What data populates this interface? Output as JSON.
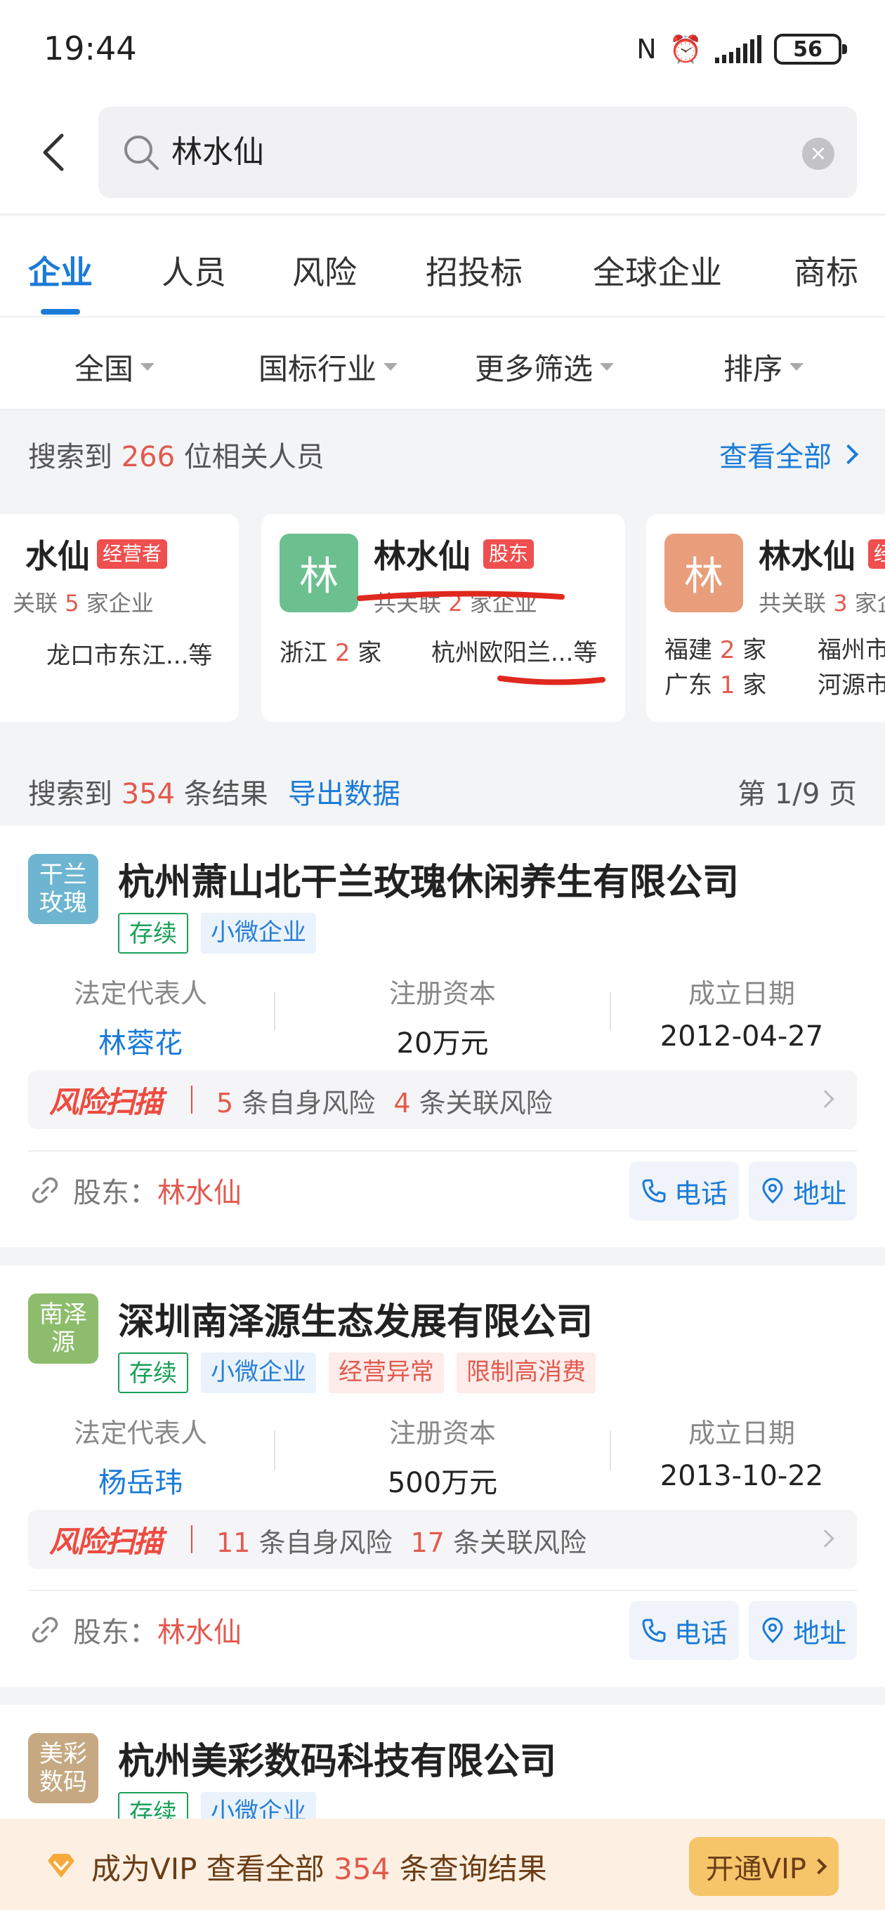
{
  "status": {
    "time": "19:44",
    "battery": "56"
  },
  "search": {
    "query": "林水仙",
    "clear": "×"
  },
  "tabs": [
    {
      "label": "企业",
      "active": true
    },
    {
      "label": "人员"
    },
    {
      "label": "风险"
    },
    {
      "label": "招投标"
    },
    {
      "label": "全球企业"
    },
    {
      "label": "商标"
    }
  ],
  "filters": [
    "全国",
    "国标行业",
    "更多筛选",
    "排序"
  ],
  "persons": {
    "prefix": "搜索到",
    "count": "266",
    "suffix": "位相关人员",
    "view_all": "查看全部",
    "cards": [
      {
        "avatar": "",
        "name": "水仙",
        "tag": "经营者",
        "sub_prefix": "关联",
        "sub_count": "5",
        "sub_suffix": "家企业",
        "line1": "龙口市东江...等"
      },
      {
        "avatar": "林",
        "avatar_color": "#6cc090",
        "name": "林水仙",
        "tag": "股东",
        "sub_prefix": "共关联",
        "sub_count": "2",
        "sub_suffix": "家企业",
        "region1": "浙江",
        "region1_count": "2",
        "unit": "家",
        "company1": "杭州欧阳兰...等"
      },
      {
        "avatar": "林",
        "avatar_color": "#e89e7b",
        "name": "林水仙",
        "tag": "经",
        "sub_prefix": "共关联",
        "sub_count": "3",
        "sub_suffix": "家企",
        "region1": "福建",
        "region1_count": "2",
        "region2": "广东",
        "region2_count": "1",
        "unit": "家",
        "company1": "福州市",
        "company2": "河源市"
      }
    ]
  },
  "results": {
    "prefix": "搜索到",
    "count": "354",
    "suffix": "条结果",
    "export": "导出数据",
    "page": "第 1/9 页"
  },
  "labels": {
    "legal_rep": "法定代表人",
    "capital": "注册资本",
    "founded": "成立日期",
    "risk_brand": "风险扫描",
    "self_risk": "条自身风险",
    "rel_risk": "条关联风险",
    "shareholder": "股东：",
    "phone": "电话",
    "address": "地址"
  },
  "companies": [
    {
      "logo": "干兰玫瑰",
      "logo_color": "#6db5d0",
      "name": "杭州萧山北干兰玫瑰休闲养生有限公司",
      "tags": [
        {
          "text": "存续",
          "style": "green"
        },
        {
          "text": "小微企业",
          "style": "blue"
        }
      ],
      "legal_rep": "林蓉花",
      "capital": "20万元",
      "founded": "2012-04-27",
      "self_risk": "5",
      "rel_risk": "4",
      "shareholder": "林水仙"
    },
    {
      "logo": "南泽源",
      "logo_color": "#8dbd6c",
      "name": "深圳南泽源生态发展有限公司",
      "tags": [
        {
          "text": "存续",
          "style": "green"
        },
        {
          "text": "小微企业",
          "style": "blue"
        },
        {
          "text": "经营异常",
          "style": "pink"
        },
        {
          "text": "限制高消费",
          "style": "pink"
        }
      ],
      "legal_rep": "杨岳玮",
      "capital": "500万元",
      "founded": "2013-10-22",
      "self_risk": "11",
      "rel_risk": "17",
      "shareholder": "林水仙"
    },
    {
      "logo": "美彩数码",
      "logo_color": "#c6a982",
      "name": "杭州美彩数码科技有限公司",
      "tags": [
        {
          "text": "存续",
          "style": "green"
        },
        {
          "text": "小微企业",
          "style": "blue"
        }
      ]
    }
  ],
  "vip": {
    "prefix": "成为VIP 查看全部",
    "count": "354",
    "suffix": "条查询结果",
    "button": "开通VIP"
  },
  "colors": {
    "accent": "#1a7bd8",
    "risk": "#e25a4e",
    "vip_bg": "#fdf0e3",
    "vip_button": "#f6c56a"
  }
}
